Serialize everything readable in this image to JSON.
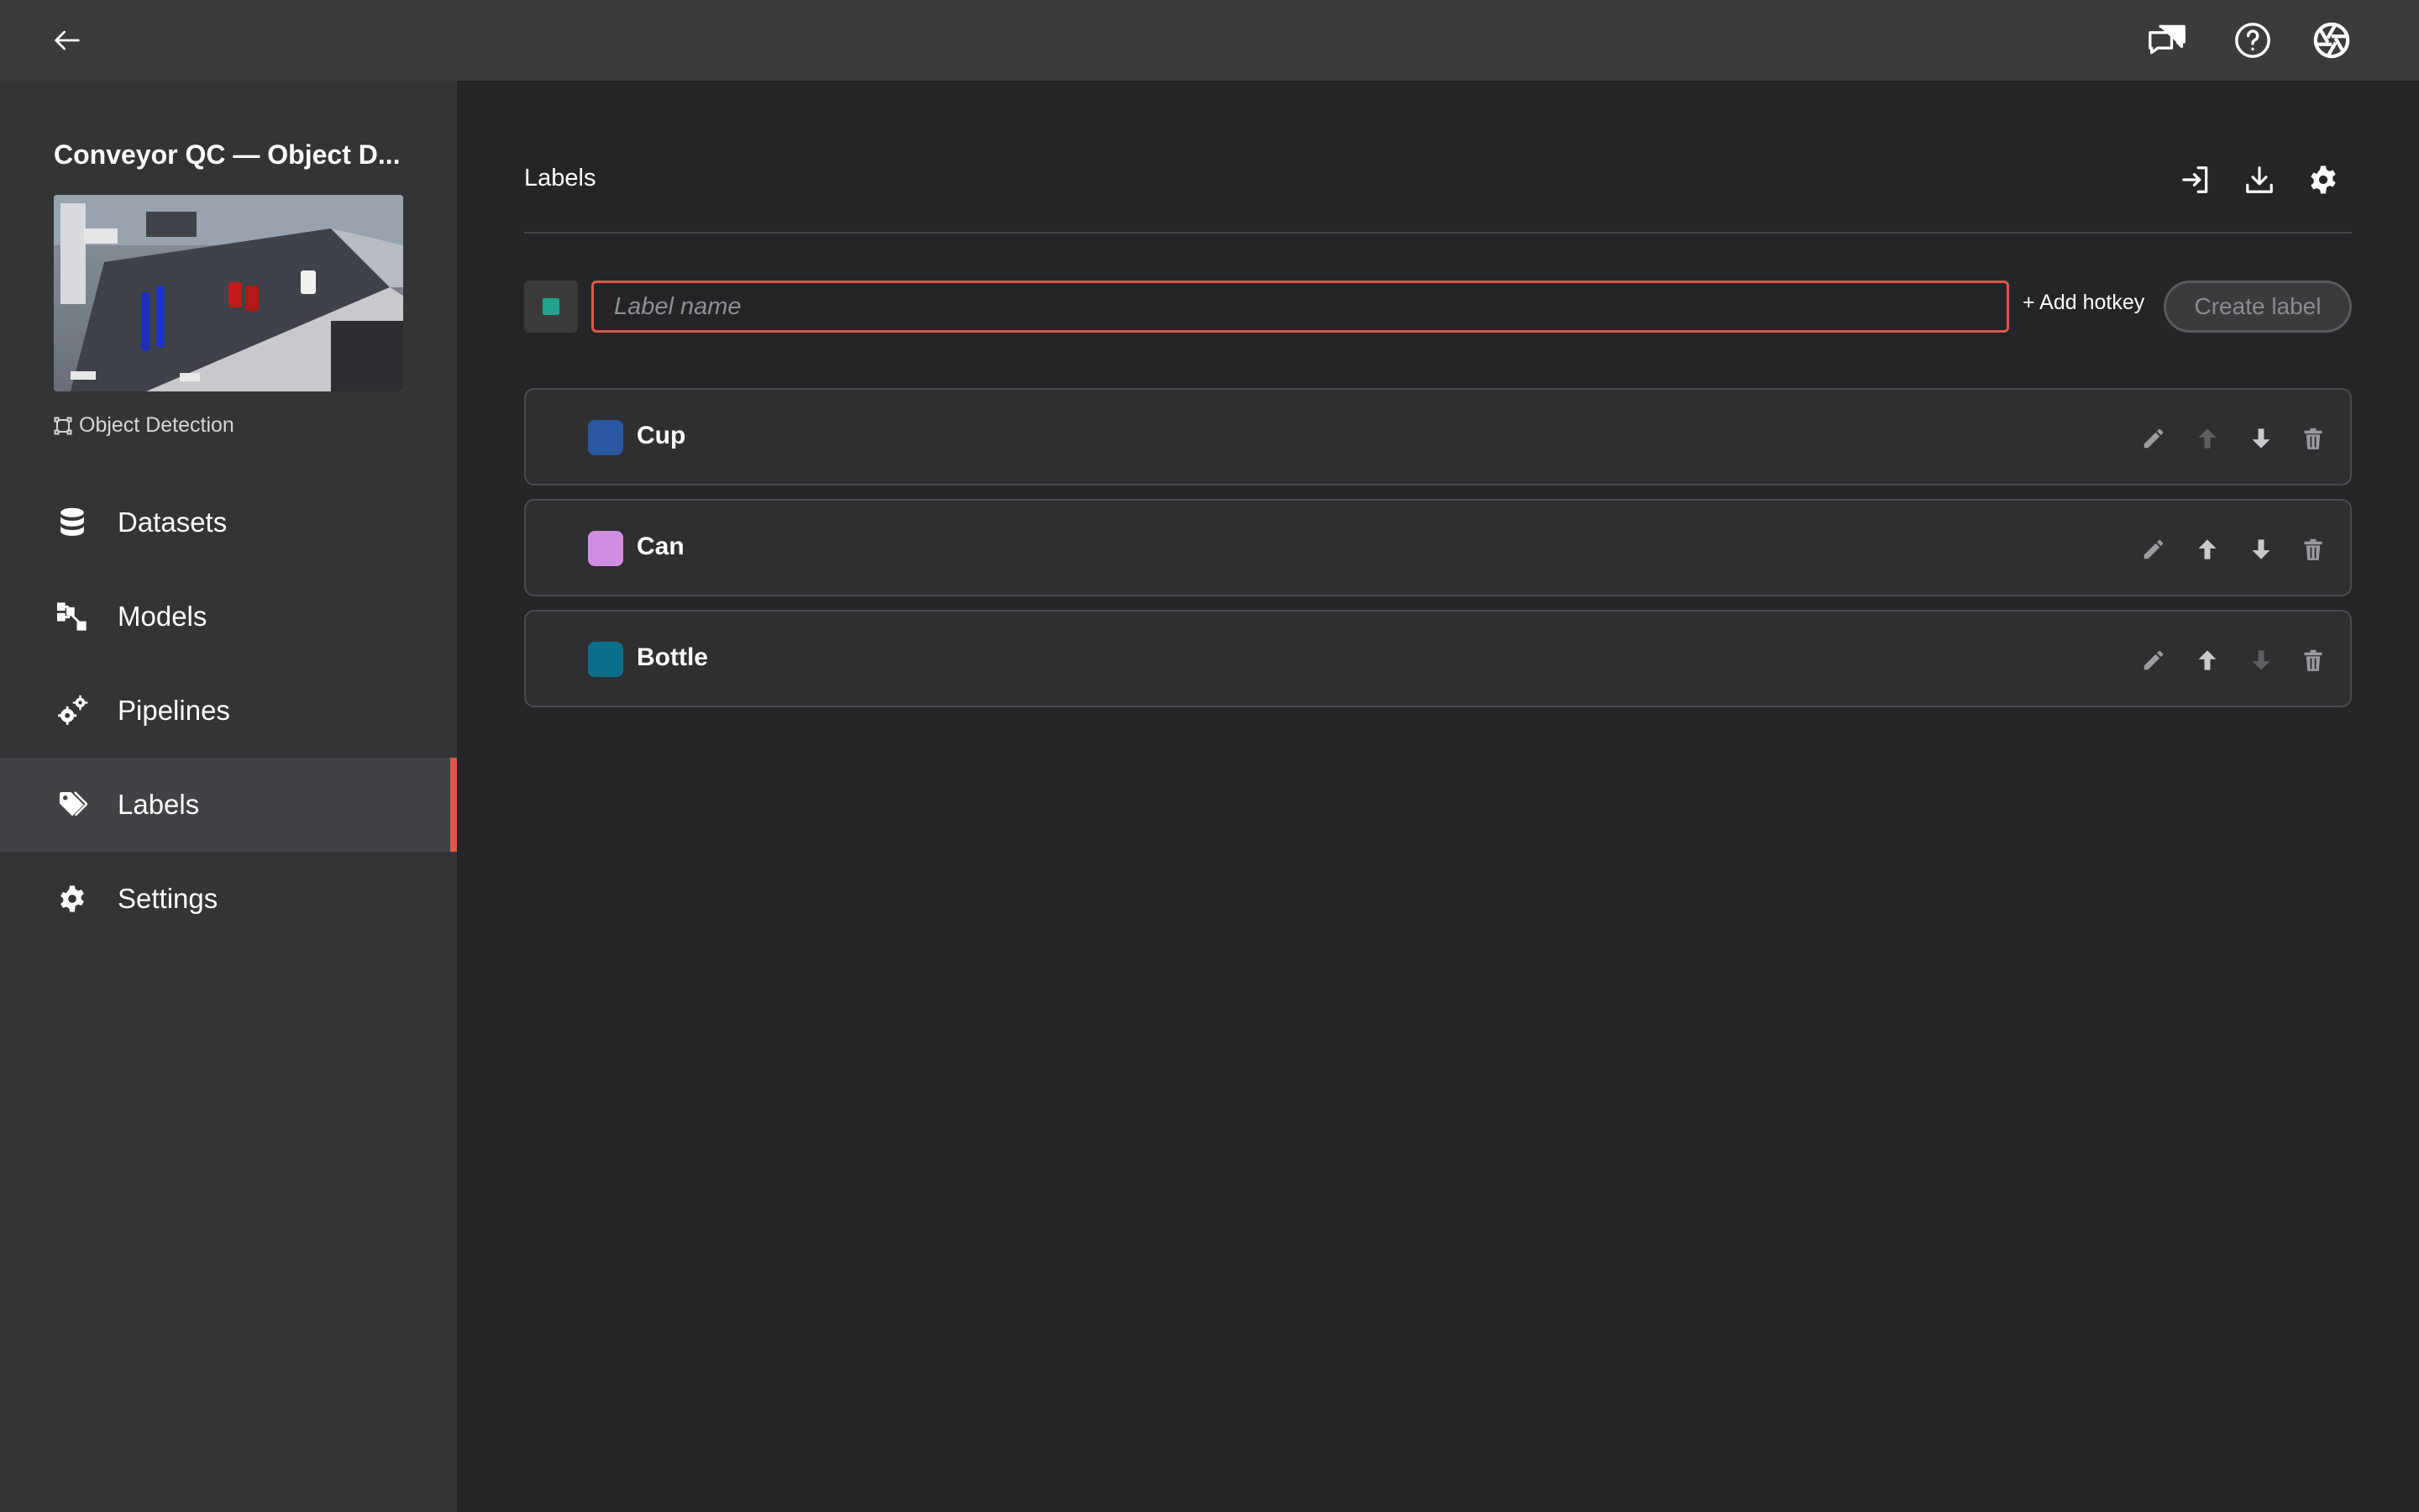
{
  "topbar": {
    "back_icon": "arrow-left-icon",
    "right_icons": [
      "chat-feedback-icon",
      "help-circle-icon",
      "camera-aperture-icon"
    ]
  },
  "sidebar": {
    "project_title": "Conveyor QC — Object D...",
    "task_type": "Object Detection",
    "nav": [
      {
        "label": "Datasets",
        "icon": "database-icon"
      },
      {
        "label": "Models",
        "icon": "model-graph-icon"
      },
      {
        "label": "Pipelines",
        "icon": "gears-icon"
      },
      {
        "label": "Labels",
        "icon": "tag-icon",
        "active": true
      },
      {
        "label": "Settings",
        "icon": "gear-icon"
      }
    ]
  },
  "main": {
    "title": "Labels",
    "header_icons": [
      "import-icon",
      "download-icon",
      "gear-icon"
    ],
    "form": {
      "placeholder": "Label name",
      "value": "",
      "swatch_color": "#21a38d",
      "add_hotkey_label": "+ Add hotkey",
      "create_label": "Create label"
    },
    "labels": [
      {
        "name": "Cup",
        "color": "#2b56a0",
        "up_disabled": true,
        "down_disabled": false
      },
      {
        "name": "Can",
        "color": "#d08ee0",
        "up_disabled": false,
        "down_disabled": false
      },
      {
        "name": "Bottle",
        "color": "#0c6f8a",
        "up_disabled": false,
        "down_disabled": true
      }
    ]
  },
  "colors": {
    "accent": "#e0574a",
    "background": "#242527",
    "sidebar": "#333436",
    "topbar": "#3a3b3d"
  }
}
